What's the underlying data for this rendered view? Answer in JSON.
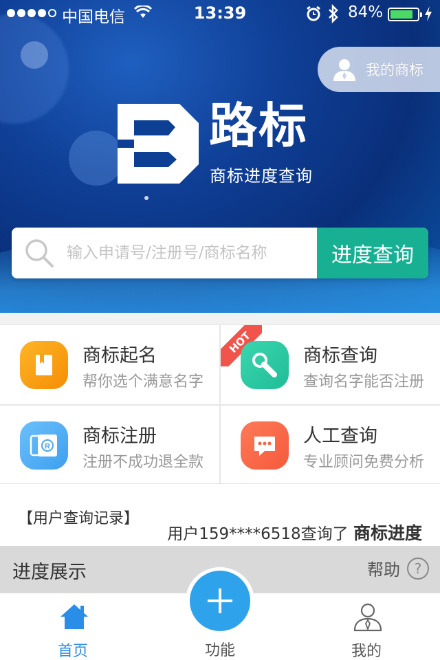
{
  "status_bar": {
    "carrier": "中国电信",
    "time": "13:39",
    "battery_percent": "84%",
    "battery_level": 0.84,
    "signal_bars": 4,
    "icons": [
      "signal-icon",
      "wifi-icon",
      "alarm-icon",
      "bluetooth-icon",
      "battery-icon",
      "charging-icon"
    ]
  },
  "header": {
    "my_trademark_label": "我的商标",
    "logo_title": "路标",
    "logo_subtitle": "商标进度查询"
  },
  "search": {
    "placeholder": "输入申请号/注册号/商标名称",
    "button_label": "进度查询"
  },
  "features": [
    {
      "title": "商标起名",
      "subtitle": "帮你选个满意名字",
      "icon": "bookmark-book-icon",
      "color": "#fba10a"
    },
    {
      "title": "商标查询",
      "subtitle": "查询名字能否注册",
      "icon": "magnifier-icon",
      "color": "#2cc9a4",
      "badge": "HOT"
    },
    {
      "title": "商标注册",
      "subtitle": "注册不成功退全款",
      "icon": "registered-cards-icon",
      "color": "#4eaef5"
    },
    {
      "title": "人工查询",
      "subtitle": "专业顾问免费分析",
      "icon": "chat-bubble-icon",
      "color": "#fb6a48"
    }
  ],
  "record": {
    "label": "【用户查询记录】",
    "text_prefix": "用户159****6518查询了",
    "text_highlight": "商标进度"
  },
  "progress": {
    "title": "进度展示",
    "help_label": "帮助",
    "help_icon_glyph": "?"
  },
  "tabbar": {
    "home_label": "首页",
    "function_label": "功能",
    "mine_label": "我的",
    "active_color": "#2a8ee8"
  }
}
